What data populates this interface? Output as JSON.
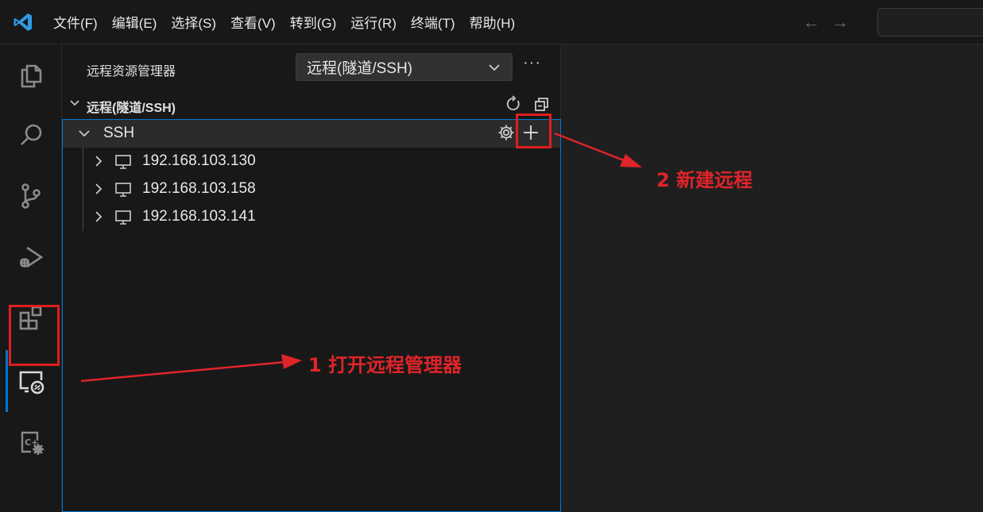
{
  "menu": [
    "文件(F)",
    "编辑(E)",
    "选择(S)",
    "查看(V)",
    "转到(G)",
    "运行(R)",
    "终端(T)",
    "帮助(H)"
  ],
  "activity_bar": {
    "icons": [
      "explorer-icon",
      "search-icon",
      "source-control-icon",
      "run-debug-icon",
      "extensions-icon",
      "remote-explorer-icon",
      "cpp-settings-icon"
    ],
    "active": "remote-explorer-icon",
    "accent": "#0078d4"
  },
  "sidebar": {
    "title": "远程资源管理器",
    "select_value": "远程(隧道/SSH)",
    "more": "···",
    "section_title": "远程(隧道/SSH)"
  },
  "tree": {
    "group_label": "SSH",
    "hosts": [
      "192.168.103.130",
      "192.168.103.158",
      "192.168.103.141"
    ]
  },
  "annotations": {
    "step1": "1 打开远程管理器",
    "step2": "2 新建远程",
    "color": "#e0242a"
  }
}
